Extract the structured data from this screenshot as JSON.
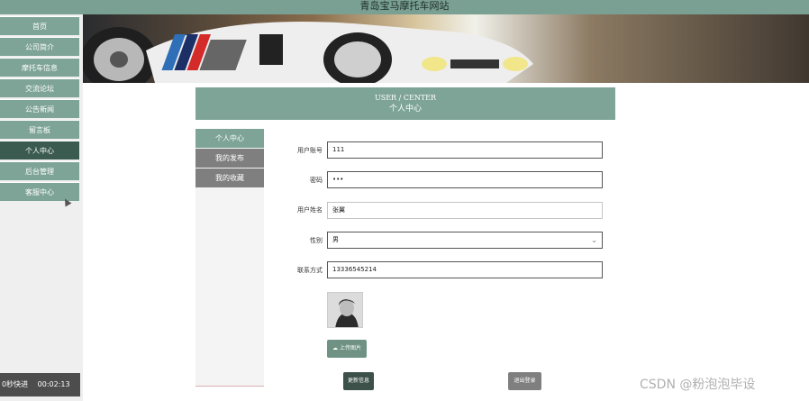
{
  "site_title": "青岛宝马摩托车网站",
  "nav": {
    "items": [
      {
        "label": "首页",
        "active": false
      },
      {
        "label": "公司简介",
        "active": false
      },
      {
        "label": "摩托车信息",
        "active": false
      },
      {
        "label": "交流论坛",
        "active": false
      },
      {
        "label": "公告新闻",
        "active": false
      },
      {
        "label": "留言板",
        "active": false
      },
      {
        "label": "个人中心",
        "active": true
      },
      {
        "label": "后台管理",
        "active": false
      },
      {
        "label": "客服中心",
        "active": false
      }
    ]
  },
  "player": {
    "speed_label": "0秒快进",
    "time": "00:02:13"
  },
  "section": {
    "title_en": "USER / CENTER",
    "title_cn": "个人中心"
  },
  "tabs": [
    {
      "label": "个人中心",
      "active": true
    },
    {
      "label": "我的发布",
      "active": false
    },
    {
      "label": "我的收藏",
      "active": false
    }
  ],
  "form": {
    "account": {
      "label": "用户账号",
      "value": "111"
    },
    "password": {
      "label": "密码",
      "value": "•••"
    },
    "name": {
      "label": "用户姓名",
      "value": "张翼"
    },
    "gender": {
      "label": "性别",
      "value": "男"
    },
    "phone": {
      "label": "联系方式",
      "value": "13336545214"
    }
  },
  "buttons": {
    "upload": "上传图片",
    "update": "更新信息",
    "logout": "退出登录"
  },
  "watermark": "CSDN @粉泡泡毕设",
  "colors": {
    "primary": "#7ea497",
    "active": "#3b5a50",
    "gray_tab": "#7f7f7f"
  },
  "icons": {
    "upload": "cloud-upload-icon",
    "cursor": "mouse-cursor-icon",
    "select": "chevron-down-icon"
  }
}
